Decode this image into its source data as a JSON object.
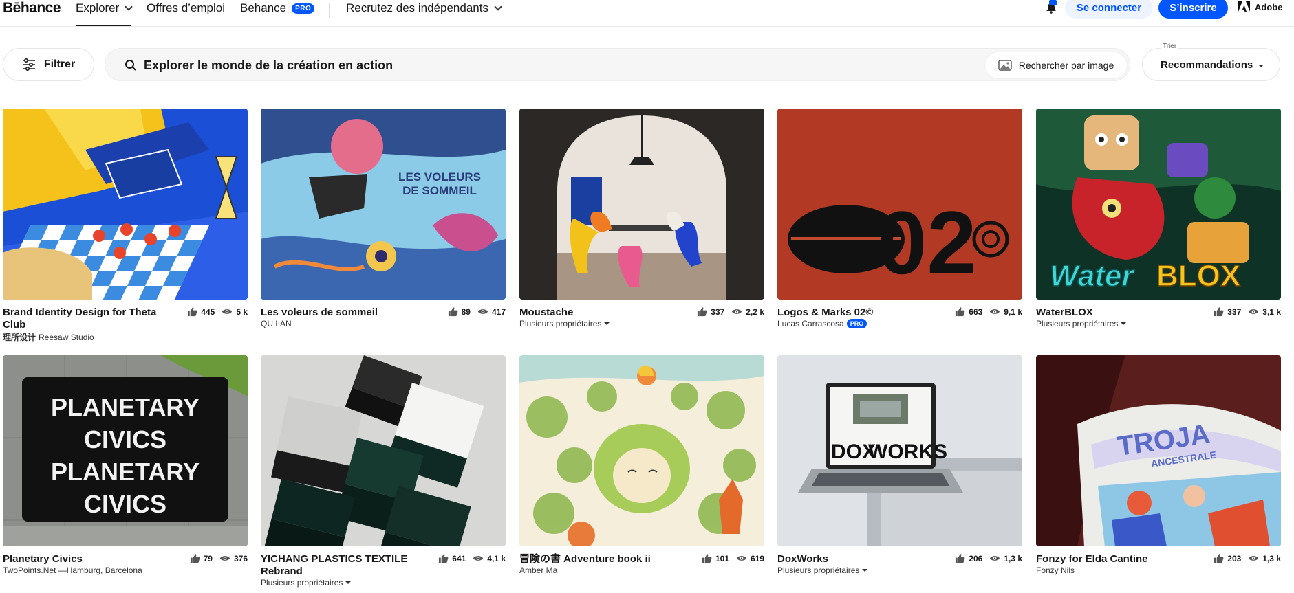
{
  "nav": {
    "logo": "Bēhance",
    "items": [
      {
        "label": "Explorer",
        "active": true,
        "has_dropdown": true
      },
      {
        "label": "Offres d’emploi",
        "active": false,
        "has_dropdown": false
      },
      {
        "label": "Behance",
        "badge": "PRO",
        "active": false,
        "has_dropdown": false
      },
      {
        "label": "Recrutez des indépendants",
        "active": false,
        "has_dropdown": true
      }
    ],
    "login_label": "Se connecter",
    "signup_label": "S’inscrire",
    "adobe_label": "Adobe",
    "icons": [
      "bell-icon",
      "adobe-logo-icon",
      "chevron-down-icon"
    ]
  },
  "toolbar": {
    "filter_label": "Filtrer",
    "search_placeholder": "Explorer le monde de la création en action",
    "image_search_label": "Rechercher par image",
    "sort_label": "Trier",
    "sort_value": "Recommandations"
  },
  "colors": {
    "accent": "#0057ff",
    "text": "#191919"
  },
  "projects": [
    {
      "title": "Brand Identity Design for Theta Club",
      "owner_prefix": "理所设计",
      "owner": "Reesaw Studio",
      "likes": "445",
      "views": "5 k"
    },
    {
      "title": "Les voleurs de sommeil",
      "owner": "QU LAN",
      "likes": "89",
      "views": "417",
      "artwork_text": [
        "LES VOLEURS",
        "DE SOMMEIL"
      ]
    },
    {
      "title": "Moustache",
      "owner": "Plusieurs propriétaires",
      "multi_owner": true,
      "likes": "337",
      "views": "2,2 k"
    },
    {
      "title": "Logos & Marks 02©",
      "owner": "Lucas Carrascosa",
      "owner_badge": "PRO",
      "likes": "663",
      "views": "9,1 k",
      "artwork_text": "02"
    },
    {
      "title": "WaterBLOX",
      "owner": "Plusieurs propriétaires",
      "multi_owner": true,
      "likes": "337",
      "views": "3,1 k",
      "artwork_text": [
        "Water",
        "BLOX"
      ]
    },
    {
      "title": "Planetary Civics",
      "owner": "TwoPoints.Net —Hamburg, Barcelona",
      "likes": "79",
      "views": "376",
      "artwork_text": [
        "PLANETARY",
        "CIVICS",
        "PLANETARY",
        "CIVICS"
      ]
    },
    {
      "title": "YICHANG PLASTICS TEXTILE Rebrand",
      "owner": "Plusieurs propriétaires",
      "multi_owner": true,
      "likes": "641",
      "views": "4,1 k"
    },
    {
      "title": "冒険の書 Adventure book ii",
      "owner": "Amber Ma",
      "likes": "101",
      "views": "619"
    },
    {
      "title": "DoxWorks",
      "owner": "Plusieurs propriétaires",
      "multi_owner": true,
      "likes": "206",
      "views": "1,3 k",
      "artwork_text": [
        "DOX",
        "WORKS"
      ]
    },
    {
      "title": "Fonzy for Elda Cantine",
      "owner": "Fonzy Nils",
      "likes": "203",
      "views": "1,3 k",
      "artwork_text": [
        "TROJA",
        "ANCESTRALE"
      ]
    }
  ]
}
